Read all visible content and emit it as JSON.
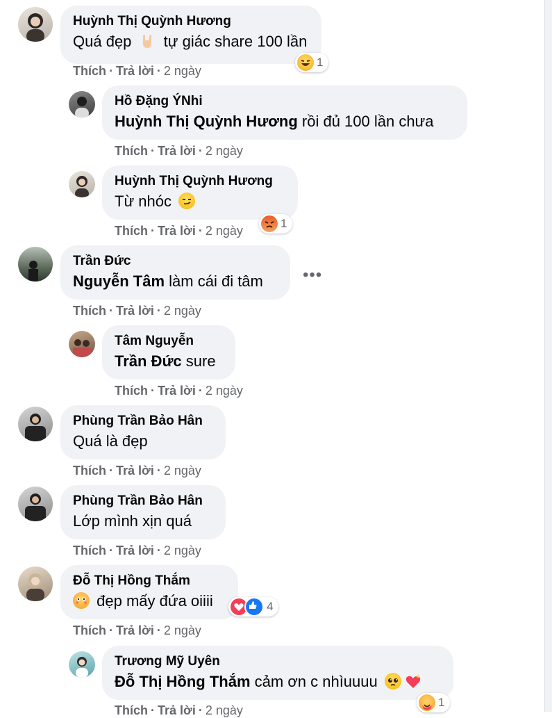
{
  "comments": [
    {
      "author": "Huỳnh Thị Quỳnh Hương",
      "mention": "",
      "text": "Quá đẹp",
      "text2": "tự giác share 100 lần",
      "actions": {
        "like": "Thích",
        "reply": "Trả lời",
        "time": "2 ngày"
      },
      "reaction_count": "1"
    },
    {
      "author": "Hồ Đặng ÝNhi",
      "mention": "Huỳnh Thị Quỳnh Hương",
      "text": "rồi đủ 100 lần chưa",
      "actions": {
        "like": "Thích",
        "reply": "Trả lời",
        "time": "2 ngày"
      }
    },
    {
      "author": "Huỳnh Thị Quỳnh Hương",
      "mention": "",
      "text": "Từ nhóc",
      "actions": {
        "like": "Thích",
        "reply": "Trả lời",
        "time": "2 ngày"
      },
      "reaction_count": "1"
    },
    {
      "author": "Trần Đức",
      "mention": "Nguyễn Tâm",
      "text": "làm cái đi tâm",
      "actions": {
        "like": "Thích",
        "reply": "Trả lời",
        "time": "2 ngày"
      },
      "more": "•••"
    },
    {
      "author": "Tâm Nguyễn",
      "mention": "Trần Đức",
      "text": "sure",
      "actions": {
        "like": "Thích",
        "reply": "Trả lời",
        "time": "2 ngày"
      }
    },
    {
      "author": "Phùng Trần Bảo Hân",
      "mention": "",
      "text": "Quá là đẹp",
      "actions": {
        "like": "Thích",
        "reply": "Trả lời",
        "time": "2 ngày"
      }
    },
    {
      "author": "Phùng Trần Bảo Hân",
      "mention": "",
      "text": "Lớp mình xịn quá",
      "actions": {
        "like": "Thích",
        "reply": "Trả lời",
        "time": "2 ngày"
      }
    },
    {
      "author": "Đỗ Thị Hồng Thắm",
      "mention": "",
      "text": "đẹp mấy đứa oiiii",
      "actions": {
        "like": "Thích",
        "reply": "Trả lời",
        "time": "2 ngày"
      },
      "reaction_count": "4"
    },
    {
      "author": "Trương Mỹ Uyên",
      "mention": "Đỗ Thị Hồng Thắm",
      "text": "cảm ơn c nhìuuuu",
      "actions": {
        "like": "Thích",
        "reply": "Trả lời",
        "time": "2 ngày"
      },
      "reaction_count": "1"
    }
  ],
  "icons": {
    "haha": "haha-reaction-icon",
    "angry": "angry-reaction-icon",
    "love": "love-reaction-icon",
    "like": "like-reaction-icon",
    "care": "care-reaction-icon"
  },
  "colors": {
    "bubble": "#f0f2f5",
    "meta": "#65676b",
    "text": "#050505",
    "like_blue": "#1877f2",
    "love_red": "#f33e58"
  }
}
